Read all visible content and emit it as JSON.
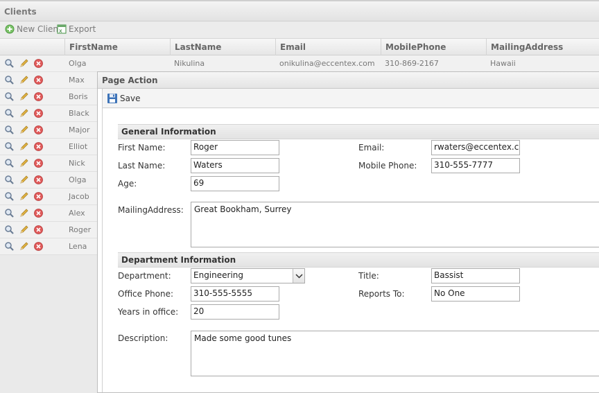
{
  "app": {
    "title": "Clients"
  },
  "toolbar": {
    "new_client": "New Client",
    "export": "Export"
  },
  "grid": {
    "columns": [
      "FirstName",
      "LastName",
      "Email",
      "MobilePhone",
      "MailingAddress"
    ],
    "rows": [
      {
        "first": "Olga",
        "last": "Nikulina",
        "email": "onikulina@eccentex.com",
        "mobile": "310-869-2167",
        "address": "Hawaii"
      },
      {
        "first": "Max"
      },
      {
        "first": "Boris"
      },
      {
        "first": "Black"
      },
      {
        "first": "Major"
      },
      {
        "first": "Elliot"
      },
      {
        "first": "Nick"
      },
      {
        "first": "Olga"
      },
      {
        "first": "Jacob"
      },
      {
        "first": "Alex"
      },
      {
        "first": "Roger"
      },
      {
        "first": "Lena"
      }
    ]
  },
  "dialog": {
    "title": "Page Action",
    "save_label": "Save",
    "general_section": "General Information",
    "first_name_label": "First Name:",
    "first_name": "Roger",
    "last_name_label": "Last Name:",
    "last_name": "Waters",
    "age_label": "Age:",
    "age": "69",
    "email_label": "Email:",
    "email": "rwaters@eccentex.com",
    "mobile_label": "Mobile Phone:",
    "mobile": "310-555-7777",
    "mailing_label": "MailingAddress:",
    "mailing": "Great Bookham, Surrey",
    "department_section": "Department Information",
    "department_label": "Department:",
    "department": "Engineering",
    "title_label": "Title:",
    "title_value": "Bassist",
    "office_phone_label": "Office Phone:",
    "office_phone": "310-555-5555",
    "reports_to_label": "Reports To:",
    "reports_to": "No One",
    "years_label": "Years in office:",
    "years": "20",
    "description_label": "Description:",
    "description": "Made some good tunes"
  },
  "icons": {
    "view": "magnifier-icon",
    "edit": "pencil-icon",
    "delete": "delete-icon",
    "add": "add-icon",
    "export": "excel-icon",
    "save": "floppy-disk-icon"
  },
  "colors": {
    "delete_red": "#e05a5a",
    "add_green": "#5cb85c",
    "pencil_yellow": "#e3b341"
  }
}
